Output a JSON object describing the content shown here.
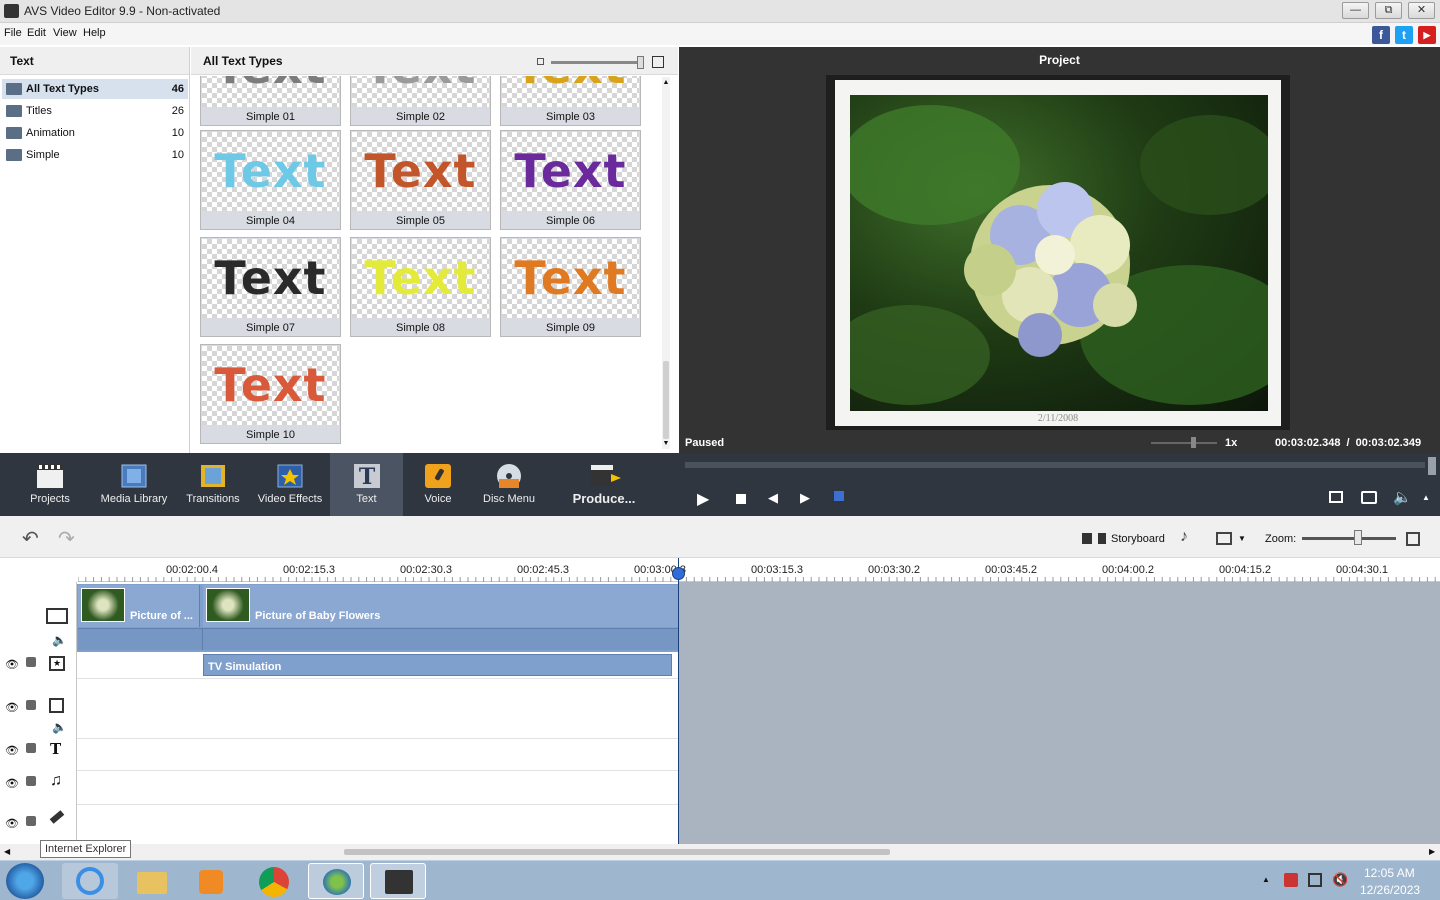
{
  "window": {
    "title": "AVS Video Editor 9.9 - Non-activated",
    "controls": [
      "minimize",
      "restore",
      "close"
    ]
  },
  "menu": [
    "File",
    "Edit",
    "View",
    "Help"
  ],
  "social": [
    {
      "name": "facebook-icon",
      "glyph": "f",
      "color": "#3b5998"
    },
    {
      "name": "twitter-icon",
      "glyph": "t",
      "color": "#1da1f2"
    },
    {
      "name": "youtube-icon",
      "glyph": "▶",
      "color": "#d62020"
    }
  ],
  "left_panel": {
    "title": "Text",
    "categories": [
      {
        "label": "All Text Types",
        "count": "46",
        "selected": true
      },
      {
        "label": "Titles",
        "count": "26"
      },
      {
        "label": "Animation",
        "count": "10"
      },
      {
        "label": "Simple",
        "count": "10"
      }
    ]
  },
  "gallery": {
    "title": "All Text Types",
    "items": [
      {
        "label": "Simple 01",
        "word": "Text",
        "color": "#7c7c7c"
      },
      {
        "label": "Simple 02",
        "word": "Text",
        "color": "#9a9a9a"
      },
      {
        "label": "Simple 03",
        "word": "Text",
        "color": "#d9a21b"
      },
      {
        "label": "Simple 04",
        "word": "Text",
        "color": "#6ec9e6"
      },
      {
        "label": "Simple 05",
        "word": "Text",
        "color": "#c2552a"
      },
      {
        "label": "Simple 06",
        "word": "Text",
        "color": "#6b2a9c"
      },
      {
        "label": "Simple 07",
        "word": "Text",
        "color": "#2a2a2a"
      },
      {
        "label": "Simple 08",
        "word": "Text",
        "color": "#e3ea3a"
      },
      {
        "label": "Simple 09",
        "word": "Text",
        "color": "#e07a22"
      },
      {
        "label": "Simple 10",
        "word": "Text",
        "color": "#d85a3a"
      }
    ]
  },
  "preview": {
    "title": "Project",
    "photo_date": "2/11/2008",
    "status": "Paused",
    "speed": "1x",
    "time_current": "00:03:02.348",
    "time_separator": "/",
    "time_total": "00:03:02.349"
  },
  "toolbar": [
    {
      "label": "Projects",
      "icon": "projects-icon"
    },
    {
      "label": "Media Library",
      "icon": "media-library-icon"
    },
    {
      "label": "Transitions",
      "icon": "transitions-icon"
    },
    {
      "label": "Video Effects",
      "icon": "video-effects-icon"
    },
    {
      "label": "Text",
      "icon": "text-icon",
      "active": true
    },
    {
      "label": "Voice",
      "icon": "voice-icon"
    },
    {
      "label": "Disc Menu",
      "icon": "disc-menu-icon"
    },
    {
      "label": "Produce...",
      "icon": "produce-icon"
    }
  ],
  "timeline_toolbar": {
    "storyboard": "Storyboard",
    "zoom_label": "Zoom:"
  },
  "ruler": [
    "00:02:00.4",
    "00:02:15.3",
    "00:02:30.3",
    "00:02:45.3",
    "00:03:00.3",
    "00:03:15.3",
    "00:03:30.2",
    "00:03:45.2",
    "00:04:00.2",
    "00:04:15.2",
    "00:04:30.1"
  ],
  "clips": {
    "video1": "Picture of ...",
    "video2": "Picture of Baby Flowers",
    "effect": "TV Simulation"
  },
  "tooltip": "Internet Explorer",
  "taskbar": {
    "time": "12:05 AM",
    "date": "12/26/2023"
  }
}
